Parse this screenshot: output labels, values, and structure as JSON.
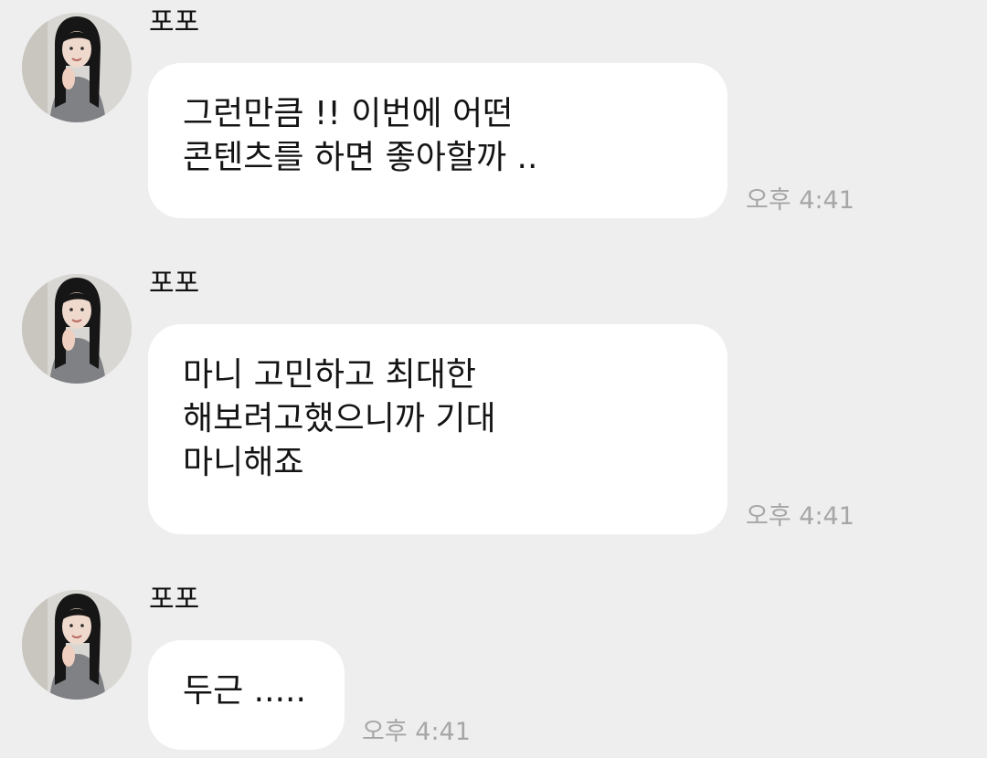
{
  "messages": [
    {
      "sender": "포포",
      "lines": [
        "그런만큼 !! 이번에 어떤",
        "콘텐츠를 하면 좋아할까 .."
      ],
      "time": "오후 4:41"
    },
    {
      "sender": "포포",
      "lines": [
        "마니 고민하고 최대한",
        "해보려고했으니까 기대",
        "마니해죠"
      ],
      "time": "오후 4:41"
    },
    {
      "sender": "포포",
      "lines": [
        "두근 ....."
      ],
      "time": "오후 4:41"
    }
  ],
  "colors": {
    "background": "#eeeeee",
    "bubble": "#ffffff",
    "text": "#141414",
    "timestamp": "#a6a6a6"
  },
  "icons": {
    "avatar": "profile-photo-avatar"
  }
}
